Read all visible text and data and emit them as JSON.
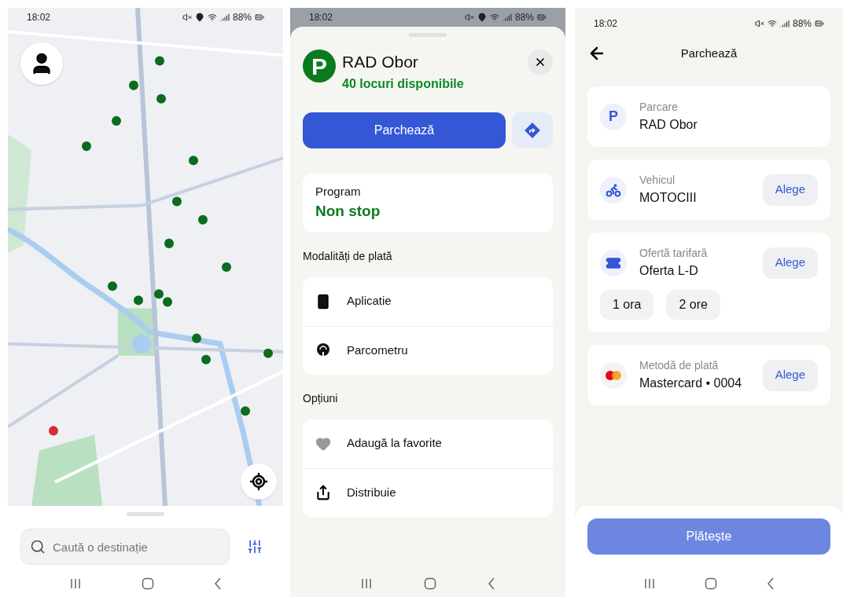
{
  "map_screen": {
    "status_bar": {
      "time": "18:02",
      "battery": "88%",
      "location": true
    },
    "search": {
      "placeholder": "Caută o destinație"
    }
  },
  "detail_screen": {
    "status_bar": {
      "time": "18:02",
      "battery": "88%",
      "location": true
    },
    "icon_text": "P",
    "title": "RAD Obor",
    "availability": "40 locuri disponibile",
    "primary_button": "Parchează",
    "schedule": {
      "label": "Program",
      "value": "Non stop"
    },
    "sections": [
      {
        "title": "Modalități de plată",
        "items": [
          {
            "kind": "phone",
            "label": "Aplicatie"
          },
          {
            "kind": "meter",
            "label": "Parcometru"
          }
        ]
      },
      {
        "title": "Opțiuni",
        "items": [
          {
            "kind": "heart",
            "label": "Adaugă la favorite"
          },
          {
            "kind": "share",
            "label": "Distribuie"
          }
        ]
      }
    ]
  },
  "checkout_screen": {
    "status_bar": {
      "time": "18:02",
      "battery": "88%",
      "location": false
    },
    "title": "Parchează",
    "cards": [
      {
        "kind": "parking",
        "icon_text": "P",
        "label": "Parcare",
        "value": "RAD Obor"
      },
      {
        "kind": "vehicle",
        "label": "Vehicul",
        "value": "MOTOCIII",
        "action": "Alege"
      },
      {
        "kind": "tariff",
        "label": "Ofertă tarifară",
        "value": "Oferta L-D",
        "action": "Alege",
        "options": [
          "1 ora",
          "2 ore"
        ]
      },
      {
        "kind": "payment",
        "label": "Metodă de plată",
        "value": "Mastercard • 0004",
        "action": "Alege"
      }
    ],
    "pay_button": {
      "label": "Plătește",
      "disabled": true
    }
  }
}
